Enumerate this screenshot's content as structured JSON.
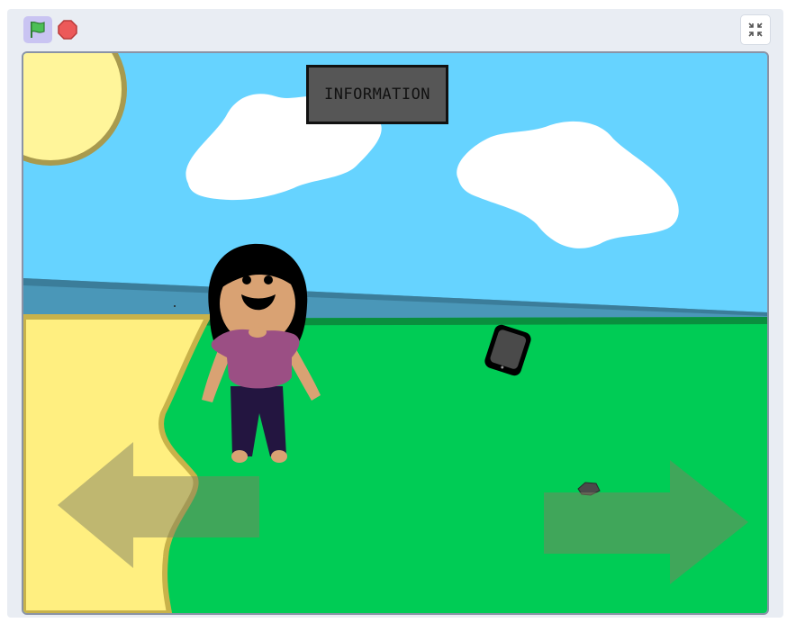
{
  "toolbar": {
    "green_flag_icon": "green-flag-icon",
    "stop_icon": "stop-sign-icon",
    "fullscreen_icon": "exit-fullscreen-icon"
  },
  "stage": {
    "info_button_label": "INFORMATION",
    "colors": {
      "sky": "#66d3ff",
      "grass": "#00cc55",
      "sand": "#ffef80",
      "water": "#4a97b8",
      "sun": "#fff59a",
      "shirt": "#9b4f84",
      "hair": "#000000",
      "skin": "#d9a273",
      "pants": "#231540"
    },
    "sprites": [
      "sun",
      "cloud",
      "cloud",
      "girl",
      "tablet",
      "rock",
      "left-arrow",
      "right-arrow",
      "information-button"
    ]
  }
}
